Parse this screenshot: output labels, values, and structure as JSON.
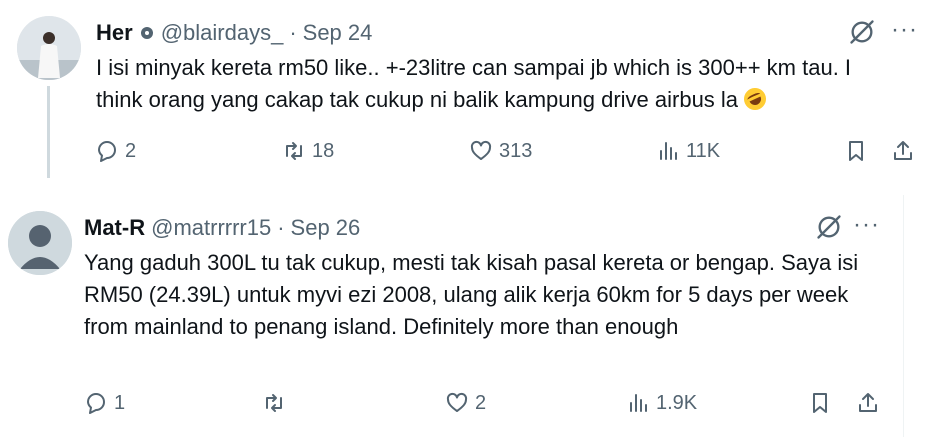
{
  "tweets": [
    {
      "name": "Her",
      "handle": "@blairdays_",
      "separator": "·",
      "date": "Sep 24",
      "text": "I isi minyak kereta rm50 like.. +-23litre can sampai jb which is 300++ km tau. I think orang yang cakap tak cukup ni balik kampung drive airbus la",
      "emoji": "rolling-on-floor-laughing",
      "replies": "2",
      "reposts": "18",
      "likes": "313",
      "views": "11K"
    },
    {
      "name": "Mat-R",
      "handle": "@matrrrrr15",
      "separator": "·",
      "date": "Sep 26",
      "text": "Yang gaduh 300L tu tak cukup, mesti tak kisah pasal kereta or bengap. Saya isi RM50 (24.39L) untuk myvi ezi 2008, ulang alik kerja 60km for 5 days per week from mainland to penang island. Definitely more than enough",
      "replies": "1",
      "reposts": "",
      "likes": "2",
      "views": "1.9K"
    }
  ],
  "more_label": "···",
  "icons": [
    "grok-icon",
    "more-icon",
    "reply-icon",
    "repost-icon",
    "like-icon",
    "views-icon",
    "bookmark-icon",
    "share-icon"
  ]
}
